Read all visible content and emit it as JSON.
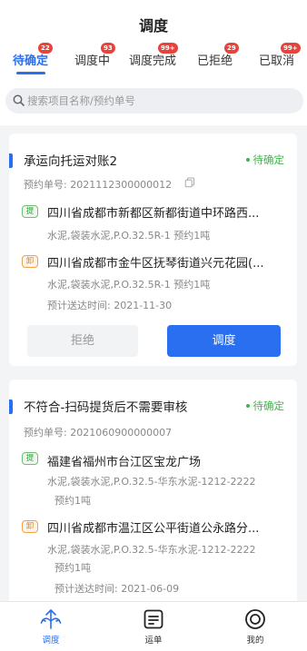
{
  "header": {
    "title": "调度"
  },
  "tabs": [
    {
      "label": "待确定",
      "badge": "22",
      "active": true
    },
    {
      "label": "调度中",
      "badge": "93"
    },
    {
      "label": "调度完成",
      "badge": "99+"
    },
    {
      "label": "已拒绝",
      "badge": "29"
    },
    {
      "label": "已取消",
      "badge": "99+"
    }
  ],
  "search": {
    "placeholder": "搜索项目名称/预约单号"
  },
  "orders": [
    {
      "title": "承运向托运对账2",
      "status": "待确定",
      "order_no": "预约单号: 2021112300000012",
      "pickup": {
        "tag": "提",
        "address": "四川省成都市新都区新都街道中环路西...",
        "detail": "水泥,袋装水泥,P.O.32.5R-1   预约1吨"
      },
      "dropoff": {
        "tag": "卸",
        "address": "四川省成都市金牛区抚琴街道兴元花园(...",
        "detail": "水泥,袋装水泥,P.O.32.5R-1   预约1吨"
      },
      "delivery_time": "预计送达时间:   2021-11-30",
      "reject_label": "拒绝",
      "dispatch_label": "调度"
    },
    {
      "title": "不符合-扫码提货后不需要审核",
      "status": "待确定",
      "order_no": "预约单号: 2021060900000007",
      "pickup": {
        "tag": "提",
        "address": "福建省福州市台江区宝龙广场",
        "detail": "水泥,袋装水泥,P.O.32.5-华东水泥-1212-2222",
        "detail2": "预约1吨"
      },
      "dropoff": {
        "tag": "卸",
        "address": "四川省成都市温江区公平街道公永路分...",
        "detail": "水泥,袋装水泥,P.O.32.5-华东水泥-1212-2222",
        "detail2": "预约1吨"
      },
      "delivery_time": "预计送达时间:   2021-06-09"
    }
  ],
  "bottom_nav": [
    {
      "label": "调度",
      "icon": "dispatch-icon",
      "active": true
    },
    {
      "label": "运单",
      "icon": "waybill-icon"
    },
    {
      "label": "我的",
      "icon": "profile-icon"
    }
  ],
  "colors": {
    "accent": "#2a6ff0",
    "badge": "#e8433a",
    "status": "#3bb54a",
    "pickup": "#3a9f3e",
    "dropoff": "#e0841c"
  }
}
